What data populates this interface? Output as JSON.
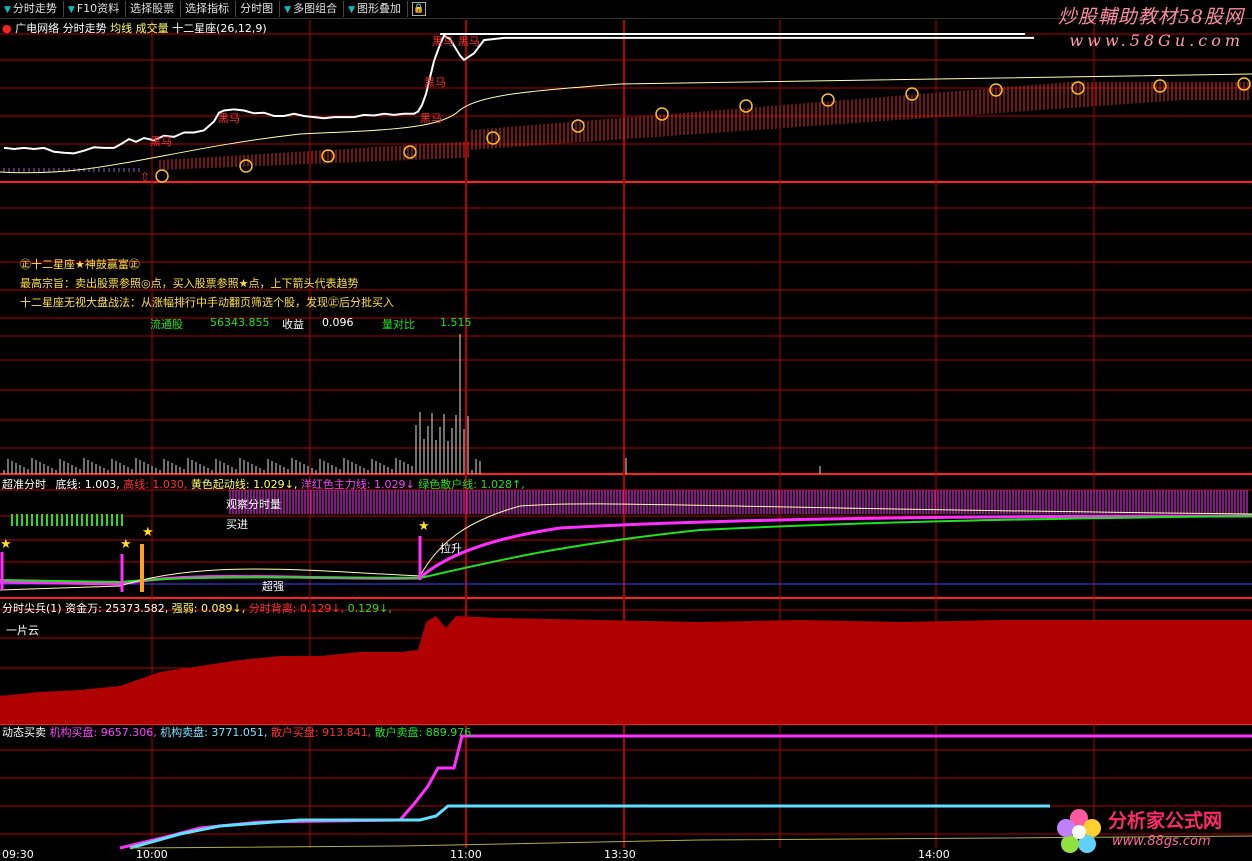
{
  "toolbar": {
    "items": [
      {
        "label": "分时走势"
      },
      {
        "label": "F10资料"
      },
      {
        "label": "选择股票"
      },
      {
        "label": "选择指标"
      },
      {
        "label": "分时图"
      },
      {
        "label": "多图组合"
      },
      {
        "label": "图形叠加"
      }
    ]
  },
  "watermark": {
    "line1": "炒股輔助教材58股网",
    "line2": "www.58Gu.com"
  },
  "main_panel": {
    "stock_name": "广电网络",
    "view": "分时走势",
    "avg_label": "均线",
    "vol_label": "成交量",
    "indicator": "十二星座(26,12,9)",
    "markers": [
      "黑马",
      "黑马",
      "黑马",
      "黑马",
      "黑马",
      "黑马"
    ],
    "title_line": "㊣十二星座★神鼓赢富㊣",
    "desc1": "最高宗旨：卖出股票参照◎点，买入股票参照★点，上下箭头代表趋势",
    "desc2": "十二星座无视大盘战法：从涨幅排行中手动翻页筛选个股，发现㊣后分批买入",
    "float_label": "流通股",
    "float_value": "56343.855",
    "eps_label": "收益",
    "eps_value": "0.096",
    "ratio_label": "量对比",
    "ratio_value": "1.515"
  },
  "panel2": {
    "title": "超准分时",
    "bottom": "底线: 1.003,",
    "top": "高线: 1.030,",
    "yellow": "黄色起动线: 1.029↓,",
    "magenta": "洋红色主力线: 1.029↓",
    "green": "绿色散户线: 1.028↑,",
    "watch": "观察分时量",
    "buy": "买进",
    "lift": "拉升",
    "strong": "超强"
  },
  "panel3": {
    "title": "分时尖兵(1)",
    "fund": "资金万: 25373.582,",
    "weak": "强弱: 0.089↓,",
    "dist": "分时背离: 0.129↓,",
    "dist2": "0.129↓,",
    "cloud": "一片云"
  },
  "panel4": {
    "title": "动态买卖",
    "inst_buy": "机构买盘: 9657.306,",
    "inst_sell": "机构卖盘: 3771.051,",
    "retail_buy": "散户买盘: 913.841,",
    "retail_sell": "散户卖盘: 889.976,"
  },
  "time_axis": {
    "labels": [
      "09:30",
      "10:00",
      "11:00",
      "13:30",
      "14:00"
    ]
  },
  "colors": {
    "grid": "#b00000",
    "price": "#ffffff",
    "avg": "#ffffb0",
    "bars": "#e03030",
    "vol": "#e0e0e0",
    "green": "#20e020",
    "magenta": "#ff30ff",
    "cyan": "#60e0ff",
    "fill": "#b00000",
    "gold": "#ffc020"
  },
  "chart_data": [
    {
      "type": "line",
      "name": "分时走势",
      "x": [
        0,
        5,
        10,
        20,
        30,
        40,
        50,
        60,
        70,
        80,
        90,
        100,
        110,
        118,
        125,
        132,
        140,
        150,
        160,
        170,
        180,
        190,
        200,
        210,
        215,
        220,
        230,
        240,
        250,
        260,
        270,
        280,
        290,
        300,
        310,
        320,
        330,
        340,
        350,
        360,
        370,
        380,
        390,
        400,
        410,
        414,
        418,
        422,
        426,
        430,
        436,
        440,
        446,
        450,
        456,
        460,
        470,
        480,
        490,
        500,
        510,
        520,
        530,
        540,
        550,
        560,
        570,
        580,
        590,
        600,
        610,
        620,
        640,
        660,
        700,
        740,
        800,
        860,
        900,
        960,
        1000,
        1030
      ],
      "price": [
        0.62,
        0.61,
        0.6,
        0.62,
        0.6,
        0.62,
        0.55,
        0.53,
        0.52,
        0.57,
        0.63,
        0.62,
        0.62,
        0.7,
        0.78,
        0.73,
        0.8,
        0.76,
        0.84,
        0.82,
        0.9,
        0.9,
        0.94,
        1.1,
        1.26,
        1.3,
        1.32,
        1.3,
        1.25,
        1.26,
        1.2,
        1.2,
        1.24,
        1.2,
        1.18,
        1.16,
        1.18,
        1.18,
        1.18,
        1.22,
        1.21,
        1.24,
        1.22,
        1.24,
        1.24,
        1.28,
        1.4,
        1.6,
        1.9,
        2.2,
        2.5,
        2.66,
        2.6,
        2.48,
        2.3,
        2.22,
        2.34,
        2.58,
        2.6,
        2.62,
        2.62,
        2.62,
        2.62,
        2.62,
        2.62,
        2.62,
        2.62,
        2.62,
        2.62,
        2.62,
        2.62,
        2.62,
        2.62,
        2.62,
        2.62,
        2.62,
        2.62,
        2.62,
        2.62,
        2.62,
        2.62,
        2.62
      ]
    }
  ]
}
